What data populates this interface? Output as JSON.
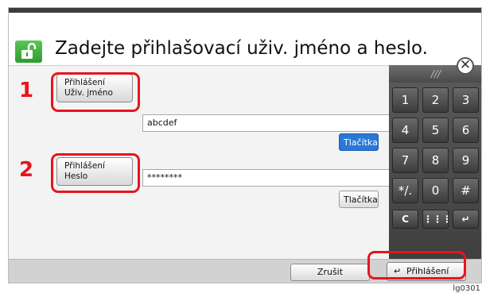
{
  "header": {
    "title": "Zadejte přihlašovací uživ. jméno a heslo."
  },
  "steps": [
    "1",
    "2"
  ],
  "fields": [
    {
      "label_line1": "Přihlášení",
      "label_line2": "Uživ. jméno",
      "value": "abcdef",
      "keyboard_label": "Tlačítka"
    },
    {
      "label_line1": "Přihlášení",
      "label_line2": "Heslo",
      "value": "********",
      "keyboard_label": "Tlačítka"
    }
  ],
  "numpad": {
    "grip": "///",
    "keys": [
      "1",
      "2",
      "3",
      "4",
      "5",
      "6",
      "7",
      "8",
      "9",
      "*/.",
      "0",
      "#"
    ],
    "bottom_keys": [
      "C",
      "⋮⋮⋮",
      "↵"
    ],
    "close_symbol": "✕"
  },
  "footer": {
    "cancel_label": "Zrušit",
    "login_label": "Přihlášení",
    "login_icon": "↵"
  },
  "figure_code": "lg0301"
}
